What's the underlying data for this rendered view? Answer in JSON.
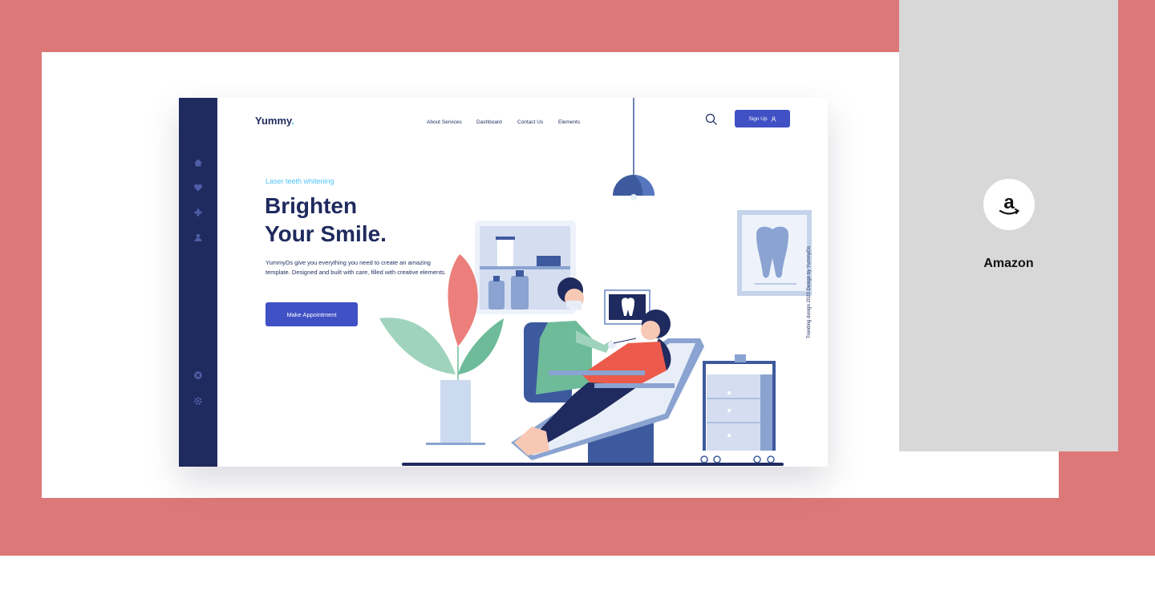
{
  "brand": {
    "name": "Yummy",
    "dot": "."
  },
  "nav": {
    "items": [
      "About Services",
      "Dashboard",
      "Contact Us",
      "Elements"
    ]
  },
  "header": {
    "signup_label": "Sign Up"
  },
  "hero": {
    "eyebrow": "Laser teeth whitening",
    "headline_line1": "Brighten",
    "headline_line2": "Your Smile.",
    "description_line1": "YummyDs give you everything you need to create an amazing",
    "description_line2": "template.  Designed and built with care, filled with creative elements.",
    "cta_label": "Make Appointment"
  },
  "credit": {
    "text": "Trending design 2020   Design by YummyDs"
  },
  "sidebar": {
    "icons": [
      "home-icon",
      "heart-icon",
      "plus-icon",
      "user-icon",
      "close-circle-icon",
      "gear-icon"
    ]
  },
  "showcase": {
    "label": "Amazon",
    "logo_glyph": "a"
  },
  "colors": {
    "background": "#dd7878",
    "panel": "#d8d8d8",
    "navy": "#1f2a5e",
    "accent": "#3f51c4",
    "light_blue": "#4fc3f7"
  }
}
